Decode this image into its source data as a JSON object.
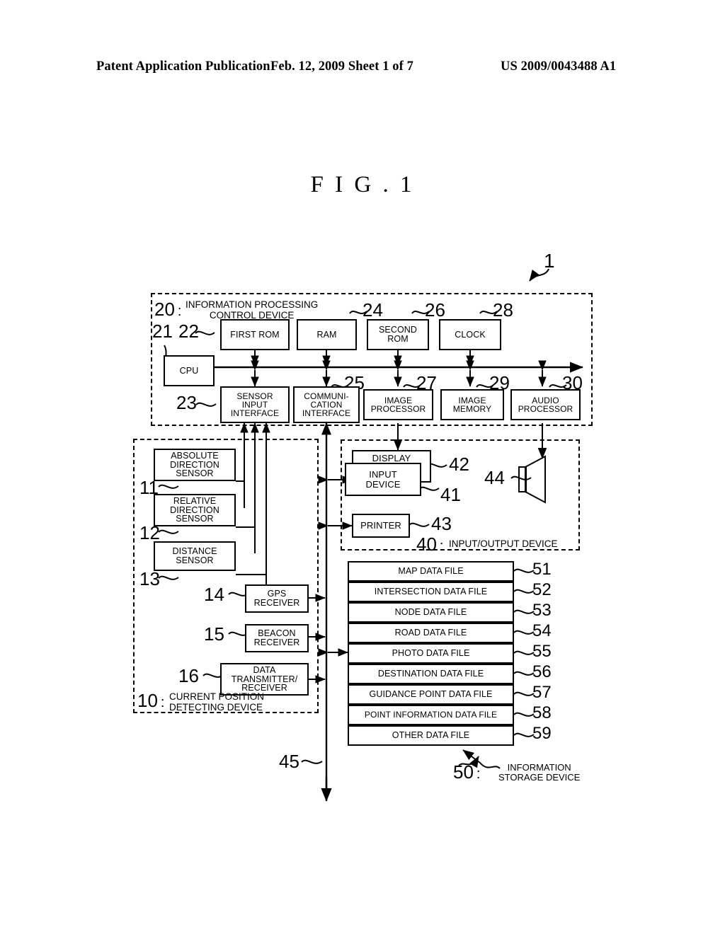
{
  "header": {
    "publication": "Patent Application Publication",
    "date_sheet": "Feb. 12, 2009  Sheet 1 of 7",
    "patent_number": "US 2009/0043488 A1"
  },
  "figure": {
    "title": "F I G . 1",
    "system_ref": "1"
  },
  "control_device": {
    "ref": "20",
    "colon": ":",
    "name_line1": "INFORMATION PROCESSING",
    "name_line2": "CONTROL DEVICE",
    "cpu": {
      "ref": "21",
      "label": "CPU"
    },
    "top_row": [
      {
        "ref": "22",
        "label": "FIRST ROM"
      },
      {
        "ref": "24",
        "label": "RAM"
      },
      {
        "ref": "26",
        "label_line1": "SECOND",
        "label_line2": "ROM"
      },
      {
        "ref": "28",
        "label": "CLOCK"
      }
    ],
    "bottom_row": [
      {
        "ref": "23",
        "label_line1": "SENSOR",
        "label_line2": "INPUT",
        "label_line3": "INTERFACE"
      },
      {
        "ref": "25",
        "label_line1": "COMMUNI-",
        "label_line2": "CATION",
        "label_line3": "INTERFACE"
      },
      {
        "ref": "27",
        "label_line1": "IMAGE",
        "label_line2": "PROCESSOR"
      },
      {
        "ref": "29",
        "label_line1": "IMAGE",
        "label_line2": "MEMORY"
      },
      {
        "ref": "30",
        "label_line1": "AUDIO",
        "label_line2": "PROCESSOR"
      }
    ]
  },
  "position_device": {
    "ref": "10",
    "colon": ":",
    "name_line1": "CURRENT POSITION",
    "name_line2": "DETECTING DEVICE",
    "items": [
      {
        "ref": "11",
        "label_line1": "ABSOLUTE",
        "label_line2": "DIRECTION",
        "label_line3": "SENSOR"
      },
      {
        "ref": "12",
        "label_line1": "RELATIVE",
        "label_line2": "DIRECTION",
        "label_line3": "SENSOR"
      },
      {
        "ref": "13",
        "label_line1": "DISTANCE",
        "label_line2": "SENSOR"
      },
      {
        "ref": "14",
        "label_line1": "GPS",
        "label_line2": "RECEIVER"
      },
      {
        "ref": "15",
        "label_line1": "BEACON",
        "label_line2": "RECEIVER"
      },
      {
        "ref": "16",
        "label_line1": "DATA",
        "label_line2": "TRANSMITTER/",
        "label_line3": "RECEIVER"
      }
    ]
  },
  "io_device": {
    "ref": "40",
    "colon": ":",
    "name": "INPUT/OUTPUT DEVICE",
    "display": {
      "ref": "42",
      "label": "DISPLAY"
    },
    "input_device": {
      "ref": "41",
      "label_line1": "INPUT",
      "label_line2": "DEVICE"
    },
    "printer": {
      "ref": "43",
      "label": "PRINTER"
    },
    "speaker": {
      "ref": "44",
      "icon": "speaker-icon"
    }
  },
  "storage_device": {
    "ref": "50",
    "colon": ":",
    "name_line1": "INFORMATION",
    "name_line2": "STORAGE DEVICE",
    "files": [
      {
        "ref": "51",
        "label": "MAP DATA FILE"
      },
      {
        "ref": "52",
        "label": "INTERSECTION DATA FILE"
      },
      {
        "ref": "53",
        "label": "NODE DATA FILE"
      },
      {
        "ref": "54",
        "label": "ROAD DATA FILE"
      },
      {
        "ref": "55",
        "label": "PHOTO DATA FILE"
      },
      {
        "ref": "56",
        "label": "DESTINATION DATA FILE"
      },
      {
        "ref": "57",
        "label": "GUIDANCE POINT DATA FILE"
      },
      {
        "ref": "58",
        "label": "POINT INFORMATION DATA FILE"
      },
      {
        "ref": "59",
        "label": "OTHER DATA FILE"
      }
    ]
  },
  "bus": {
    "ref": "45"
  }
}
